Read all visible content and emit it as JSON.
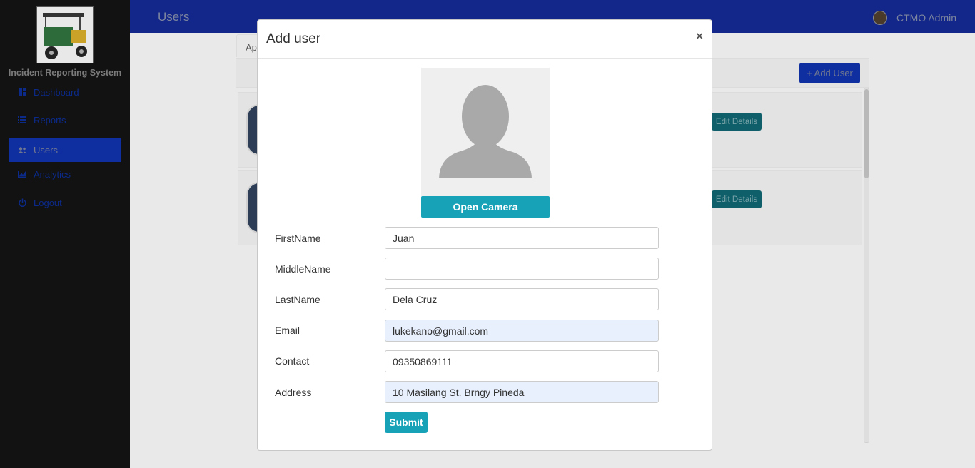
{
  "sidebar": {
    "brand": "Incident Reporting System",
    "items": [
      {
        "label": "Dashboard",
        "icon": "dashboard-icon"
      },
      {
        "label": "Reports",
        "icon": "list-icon"
      },
      {
        "label": "Users",
        "icon": "users-icon",
        "active": true
      },
      {
        "label": "Analytics",
        "icon": "chart-icon"
      },
      {
        "label": "Logout",
        "icon": "power-icon"
      }
    ]
  },
  "header": {
    "title": "Users",
    "admin_name": "CTMO Admin"
  },
  "background": {
    "tab_label": "Ap",
    "add_user_label": "+ Add User",
    "edit_details_label": "Edit Details"
  },
  "modal": {
    "title": "Add user",
    "close_label": "×",
    "open_camera_label": "Open Camera",
    "submit_label": "Submit",
    "fields": {
      "first_name": {
        "label": "FirstName",
        "value": "Juan"
      },
      "middle_name": {
        "label": "MiddleName",
        "value": ""
      },
      "last_name": {
        "label": "LastName",
        "value": "Dela Cruz"
      },
      "email": {
        "label": "Email",
        "value": "lukekano@gmail.com"
      },
      "contact": {
        "label": "Contact",
        "value": "09350869111"
      },
      "address": {
        "label": "Address",
        "value": "10 Masilang St. Brngy Pineda"
      }
    }
  },
  "colors": {
    "accent": "#17a2b8",
    "topbar": "#13268a",
    "sidebar": "#121212"
  }
}
